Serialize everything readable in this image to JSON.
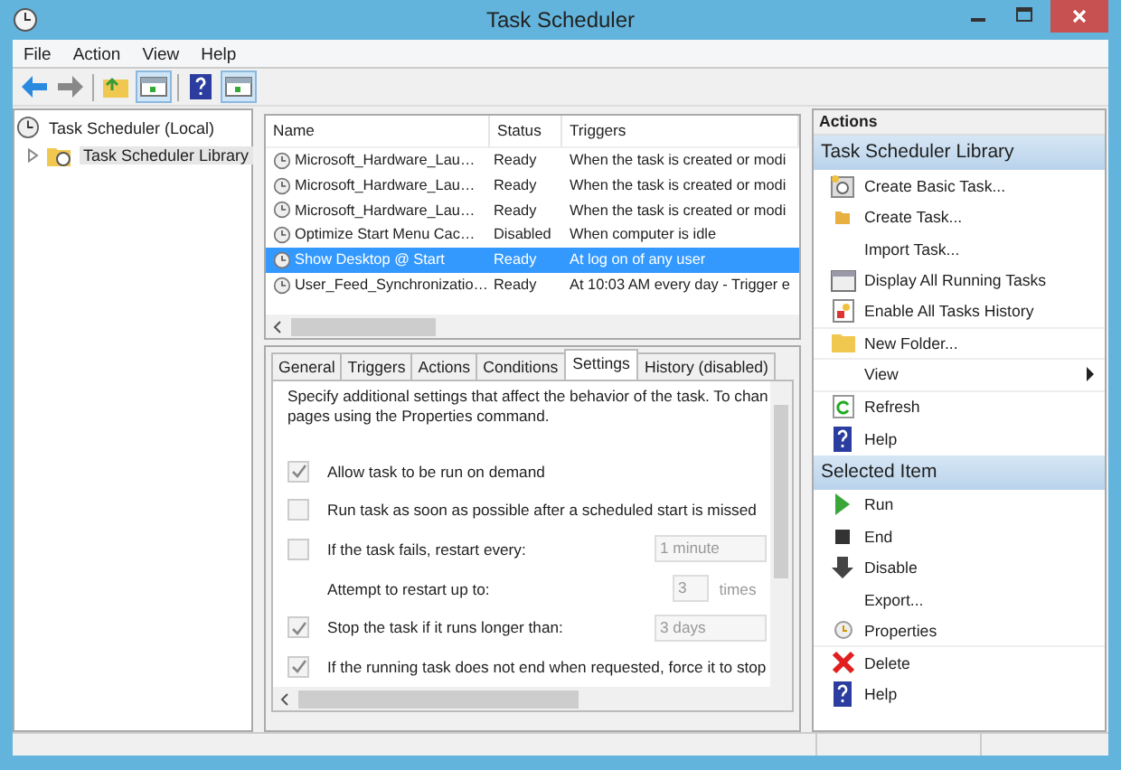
{
  "window": {
    "title": "Task Scheduler"
  },
  "menu": [
    "File",
    "Action",
    "View",
    "Help"
  ],
  "tree": [
    {
      "label": "Task Scheduler (Local)",
      "selected": false,
      "children": [
        {
          "label": "Task Scheduler Library",
          "selected": true,
          "expanded": false
        }
      ]
    }
  ],
  "tasks": {
    "columns": [
      "Name",
      "Status",
      "Triggers"
    ],
    "rows": [
      {
        "name": "Microsoft_Hardware_Lau…",
        "status": "Ready",
        "trigger": "When the task is created or modi",
        "selected": false
      },
      {
        "name": "Microsoft_Hardware_Lau…",
        "status": "Ready",
        "trigger": "When the task is created or modi",
        "selected": false
      },
      {
        "name": "Microsoft_Hardware_Lau…",
        "status": "Ready",
        "trigger": "When the task is created or modi",
        "selected": false
      },
      {
        "name": "Optimize Start Menu Cac…",
        "status": "Disabled",
        "trigger": "When computer is idle",
        "selected": false
      },
      {
        "name": "Show Desktop @ Start",
        "status": "Ready",
        "trigger": "At log on of any user",
        "selected": true
      },
      {
        "name": "User_Feed_Synchronizatio…",
        "status": "Ready",
        "trigger": "At 10:03 AM every day - Trigger e",
        "selected": false
      }
    ]
  },
  "tabs": [
    {
      "label": "General",
      "selected": false
    },
    {
      "label": "Triggers",
      "selected": false
    },
    {
      "label": "Actions",
      "selected": false
    },
    {
      "label": "Conditions",
      "selected": false
    },
    {
      "label": "Settings",
      "selected": true
    },
    {
      "label": "History (disabled)",
      "selected": false
    }
  ],
  "settings": {
    "description_lines": [
      "Specify additional settings that affect the behavior of the task. To chan",
      "pages using the Properties command."
    ],
    "options": [
      {
        "kind": "checkbox",
        "label": "Allow task to be run on demand",
        "checked": true
      },
      {
        "kind": "checkbox",
        "label": "Run task as soon as possible after a scheduled start is missed",
        "checked": false
      },
      {
        "kind": "checkbox",
        "label": "If the task fails, restart every:",
        "checked": false,
        "value": "1 minute"
      },
      {
        "kind": "count",
        "label": "Attempt to restart up to:",
        "value": "3",
        "unit": "times"
      },
      {
        "kind": "checkbox",
        "label": "Stop the task if it runs longer than:",
        "checked": true,
        "value": "3 days"
      },
      {
        "kind": "checkbox",
        "label": "If the running task does not end when requested, force it to stop",
        "checked": true
      }
    ]
  },
  "actions": {
    "title": "Actions",
    "sections": [
      {
        "title": "Task Scheduler Library",
        "items": [
          {
            "label": "Create Basic Task...",
            "kind": "wizard",
            "divider": false
          },
          {
            "label": "Create Task...",
            "kind": "folder-small",
            "divider": false
          },
          {
            "label": "Import Task...",
            "kind": "none",
            "divider": false
          },
          {
            "label": "Display All Running Tasks",
            "kind": "window",
            "divider": false
          },
          {
            "label": "Enable All Tasks History",
            "kind": "history",
            "divider": true
          },
          {
            "label": "New Folder...",
            "kind": "folder",
            "divider": true
          },
          {
            "label": "View",
            "kind": "submenu",
            "divider": true
          },
          {
            "label": "Refresh",
            "kind": "refresh",
            "divider": false
          },
          {
            "label": "Help",
            "kind": "help",
            "divider": false
          }
        ]
      },
      {
        "title": "Selected Item",
        "items": [
          {
            "label": "Run",
            "kind": "run",
            "divider": false
          },
          {
            "label": "End",
            "kind": "stop",
            "divider": false
          },
          {
            "label": "Disable",
            "kind": "down",
            "divider": false
          },
          {
            "label": "Export...",
            "kind": "none",
            "divider": false
          },
          {
            "label": "Properties",
            "kind": "clock",
            "divider": true
          },
          {
            "label": "Delete",
            "kind": "delete",
            "divider": false
          },
          {
            "label": "Help",
            "kind": "help",
            "divider": false
          }
        ]
      }
    ]
  }
}
